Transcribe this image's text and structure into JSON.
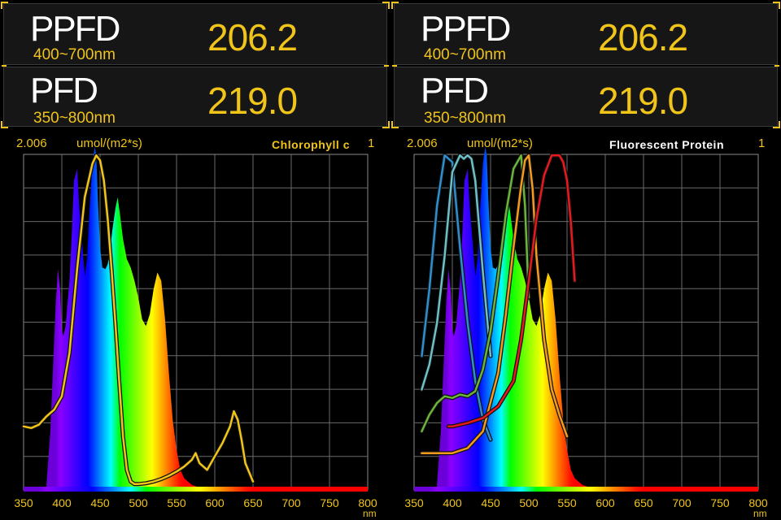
{
  "panels": [
    {
      "ppfd": {
        "label": "PPFD",
        "range": "400~700nm",
        "value": "206.2"
      },
      "pfd": {
        "label": "PFD",
        "range": "350~800nm",
        "value": "219.0"
      },
      "y_max": "2.006",
      "unit": "umol/(m2*s)",
      "y_right": "1",
      "spectrum_name": "Chlorophyll c",
      "spectrum_name_color": "#f0c419"
    },
    {
      "ppfd": {
        "label": "PPFD",
        "range": "400~700nm",
        "value": "206.2"
      },
      "pfd": {
        "label": "PFD",
        "range": "350~800nm",
        "value": "219.0"
      },
      "y_max": "2.006",
      "unit": "umol/(m2*s)",
      "y_right": "1",
      "spectrum_name": "Fluorescent Protein",
      "spectrum_name_color": "#ffffff"
    }
  ],
  "chart_data": {
    "type": "area",
    "xlim": [
      350,
      800
    ],
    "ylim": [
      0,
      2.006
    ],
    "x_ticks": [
      350,
      400,
      450,
      500,
      550,
      600,
      650,
      700,
      750,
      800
    ],
    "x_unit": "nm",
    "grid": true,
    "spectrum": {
      "x": [
        380,
        385,
        390,
        392,
        395,
        398,
        400,
        402,
        405,
        410,
        413,
        416,
        420,
        423,
        427,
        430,
        433,
        436,
        440,
        443,
        445,
        447,
        450,
        453,
        457,
        460,
        463,
        466,
        470,
        473,
        476,
        480,
        485,
        490,
        495,
        500,
        505,
        510,
        515,
        520,
        525,
        530,
        535,
        540,
        545,
        550,
        555,
        560,
        570,
        580,
        600,
        620,
        650
      ],
      "y": [
        0.04,
        0.35,
        0.9,
        1.12,
        1.32,
        1.18,
        0.95,
        0.92,
        0.98,
        1.25,
        1.52,
        1.85,
        1.92,
        1.68,
        1.45,
        1.28,
        1.38,
        1.65,
        1.95,
        2.05,
        2.0,
        1.75,
        1.45,
        1.33,
        1.32,
        1.35,
        1.42,
        1.55,
        1.68,
        1.75,
        1.65,
        1.5,
        1.38,
        1.33,
        1.25,
        1.15,
        1.02,
        0.98,
        1.05,
        1.2,
        1.3,
        1.25,
        1.02,
        0.7,
        0.42,
        0.24,
        0.12,
        0.07,
        0.03,
        0.015,
        0.008,
        0.005,
        0.0
      ]
    },
    "overlays": [
      {
        "panel": 0,
        "color": "#f0c419",
        "x": [
          350,
          360,
          370,
          380,
          390,
          400,
          410,
          420,
          430,
          440,
          445,
          450,
          455,
          460,
          465,
          470,
          475,
          480,
          485,
          490,
          495,
          500,
          510,
          520,
          530,
          540,
          550,
          560,
          570,
          575,
          580,
          590,
          600,
          610,
          620,
          625,
          630,
          635,
          640,
          650
        ],
        "y": [
          0.38,
          0.37,
          0.39,
          0.44,
          0.48,
          0.56,
          0.82,
          1.32,
          1.75,
          1.95,
          2.0,
          1.97,
          1.85,
          1.62,
          1.32,
          1.0,
          0.65,
          0.32,
          0.12,
          0.05,
          0.035,
          0.035,
          0.04,
          0.05,
          0.065,
          0.085,
          0.11,
          0.14,
          0.18,
          0.22,
          0.16,
          0.12,
          0.2,
          0.28,
          0.38,
          0.47,
          0.42,
          0.3,
          0.16,
          0.05
        ]
      },
      {
        "panel": 1,
        "color": "#2e8fd0",
        "x": [
          360,
          370,
          380,
          390,
          400,
          410,
          420,
          430,
          440,
          450
        ],
        "y": [
          0.8,
          1.2,
          1.7,
          2.0,
          1.96,
          1.45,
          1.0,
          0.65,
          0.42,
          0.3
        ]
      },
      {
        "panel": 1,
        "color": "#6ec0c8",
        "x": [
          360,
          370,
          380,
          390,
          400,
          410,
          415,
          420,
          425,
          430,
          440,
          450
        ],
        "y": [
          0.6,
          0.75,
          1.0,
          1.4,
          1.9,
          2.0,
          1.98,
          2.0,
          1.98,
          1.85,
          1.3,
          0.8
        ]
      },
      {
        "panel": 1,
        "color": "#6ab53a",
        "x": [
          360,
          370,
          380,
          390,
          400,
          410,
          420,
          430,
          440,
          450,
          460,
          470,
          480,
          490,
          495,
          500
        ],
        "y": [
          0.35,
          0.45,
          0.52,
          0.56,
          0.55,
          0.57,
          0.56,
          0.59,
          0.72,
          0.95,
          1.28,
          1.65,
          1.92,
          2.0,
          1.7,
          1.15
        ]
      },
      {
        "panel": 1,
        "color": "#f59a1c",
        "x": [
          360,
          380,
          400,
          420,
          440,
          460,
          470,
          480,
          490,
          495,
          500,
          505,
          510,
          520,
          530,
          540,
          550
        ],
        "y": [
          0.22,
          0.22,
          0.22,
          0.25,
          0.35,
          0.7,
          1.05,
          1.45,
          1.82,
          1.97,
          2.0,
          1.8,
          1.4,
          0.9,
          0.6,
          0.45,
          0.32
        ]
      },
      {
        "panel": 1,
        "color": "#e8181c",
        "x": [
          395,
          400,
          420,
          440,
          460,
          480,
          490,
          500,
          510,
          520,
          530,
          540,
          545,
          550,
          555,
          560
        ],
        "y": [
          0.38,
          0.38,
          0.4,
          0.43,
          0.5,
          0.65,
          0.9,
          1.25,
          1.62,
          1.88,
          2.0,
          2.0,
          1.96,
          1.85,
          1.6,
          1.25
        ]
      }
    ]
  }
}
